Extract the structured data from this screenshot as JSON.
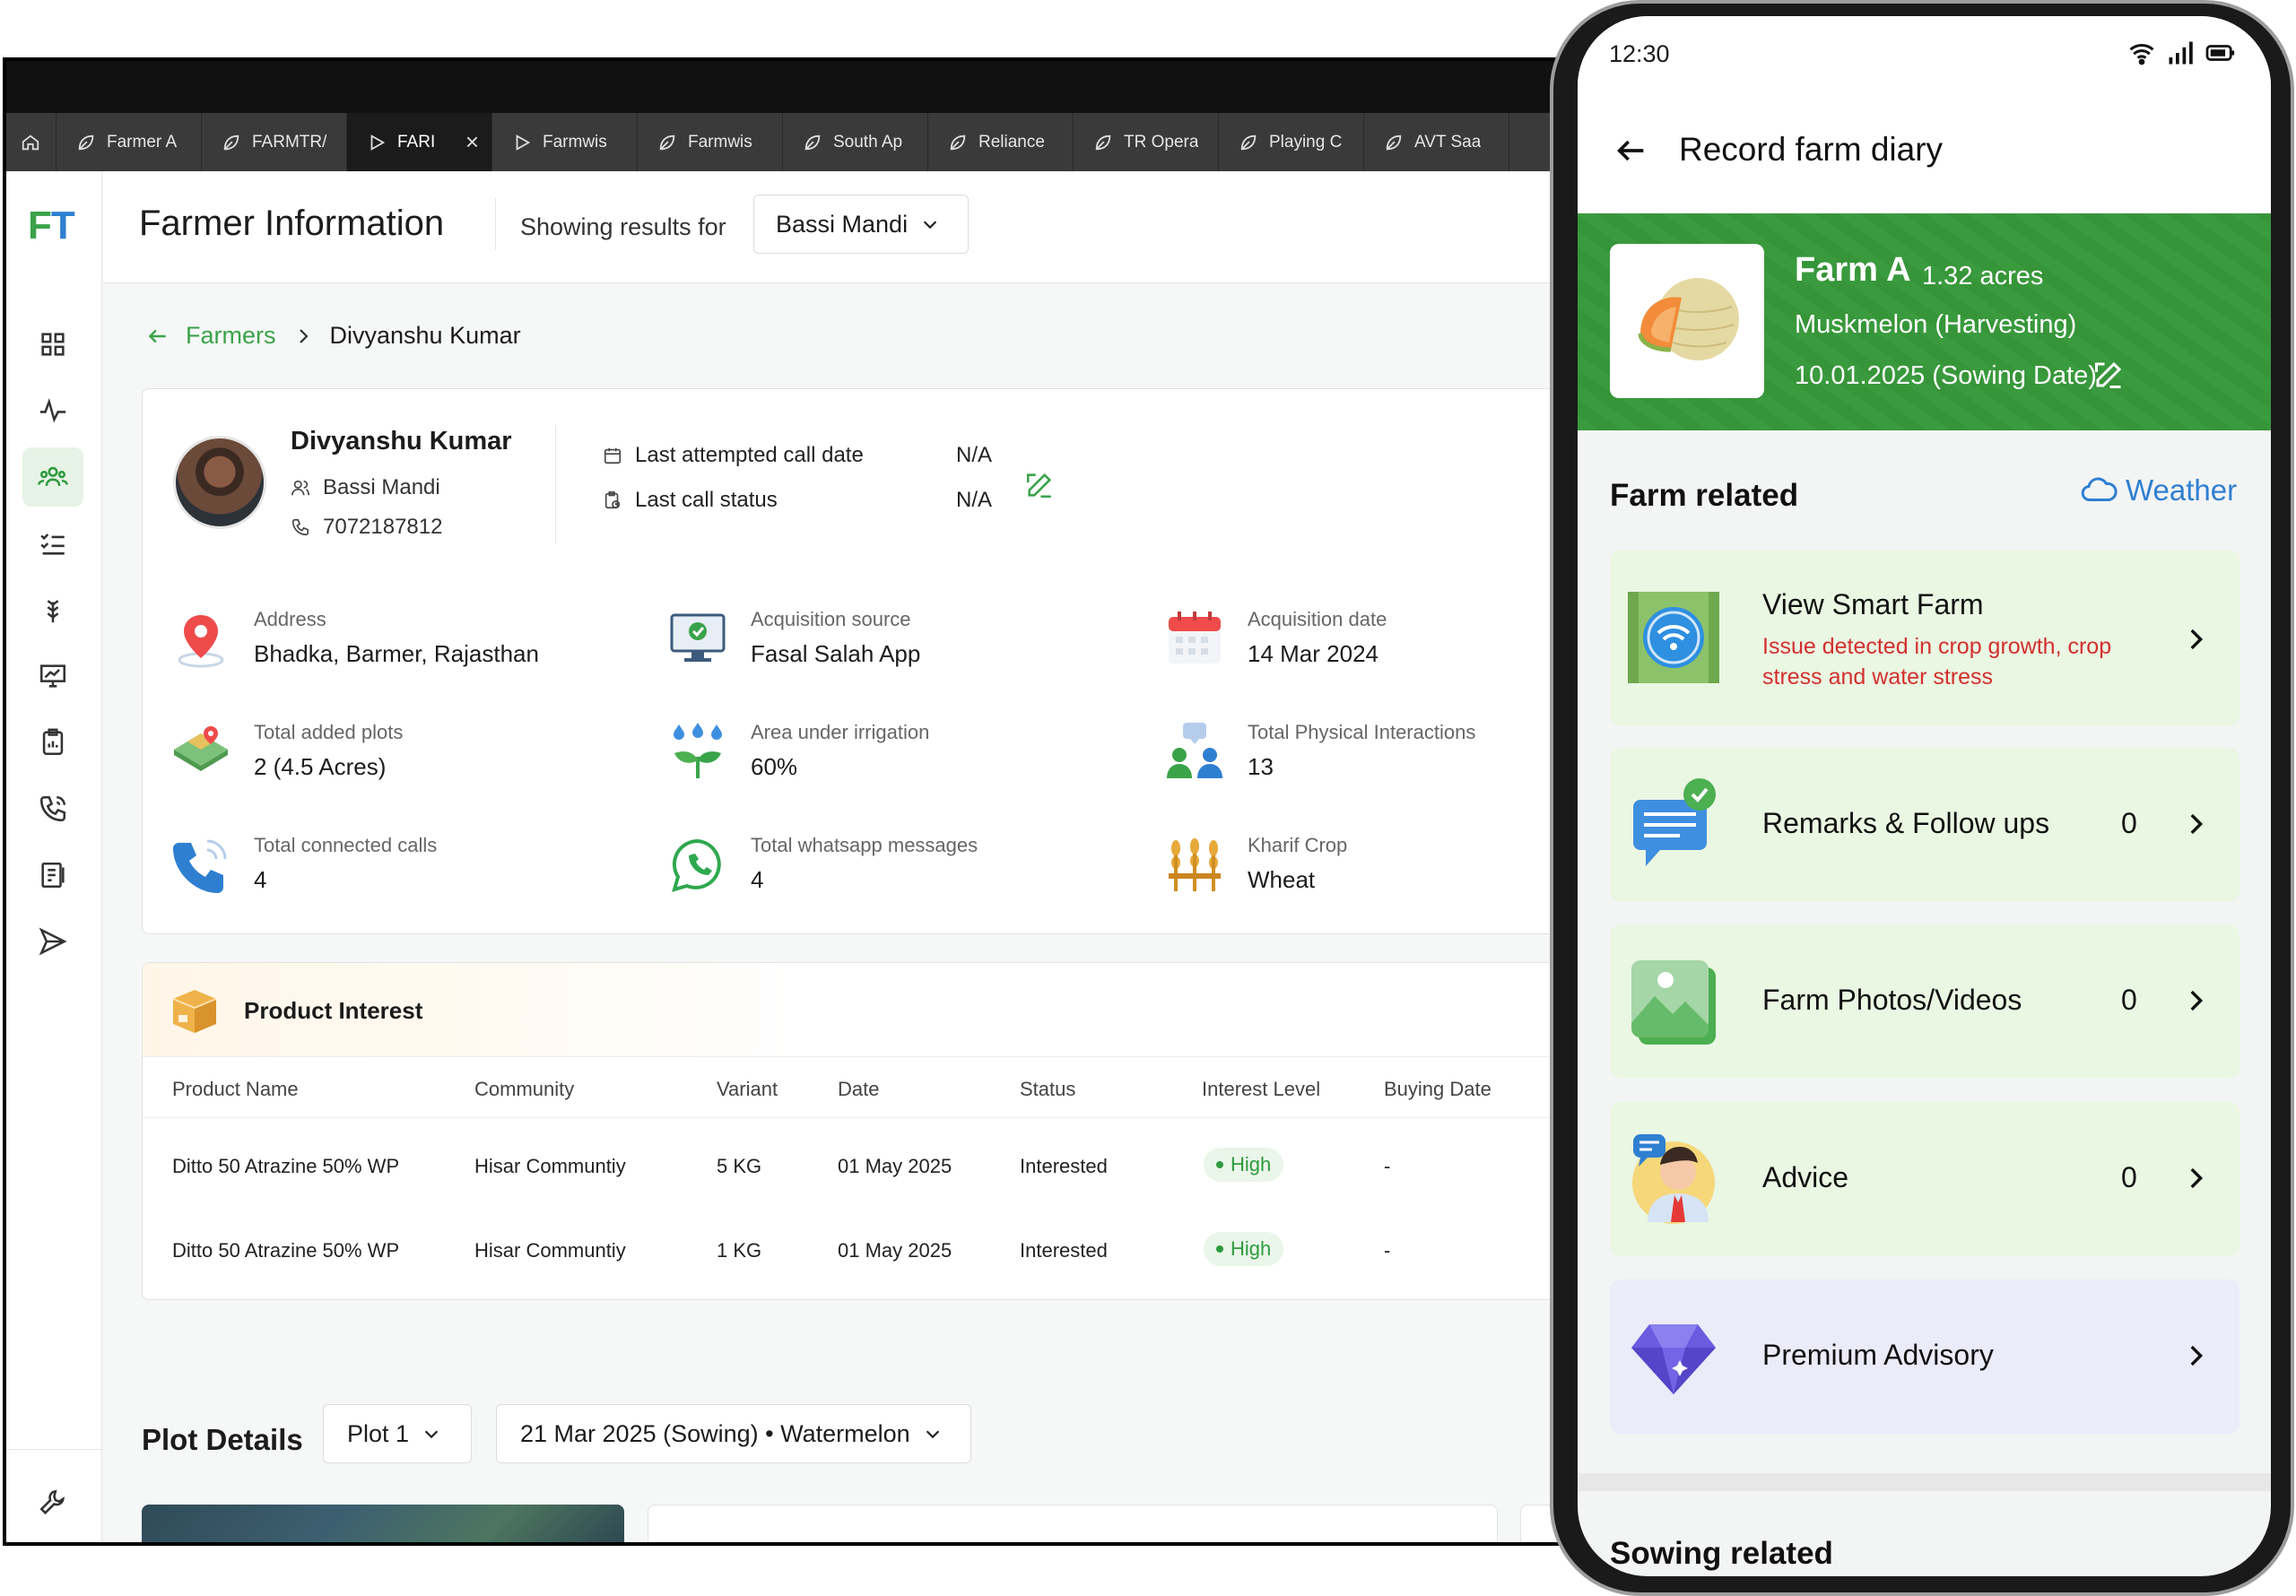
{
  "tabs": [
    {
      "label": "Farmer A",
      "icon": "leaf-icon"
    },
    {
      "label": "FARMTR/",
      "icon": "leaf-icon"
    },
    {
      "label": "FARI",
      "icon": "play-icon",
      "active": true
    },
    {
      "label": "Farmwis",
      "icon": "play-icon"
    },
    {
      "label": "Farmwis",
      "icon": "leaf-icon"
    },
    {
      "label": "South Ap",
      "icon": "leaf-icon"
    },
    {
      "label": "Reliance",
      "icon": "leaf-icon"
    },
    {
      "label": "TR Opera",
      "icon": "leaf-icon"
    },
    {
      "label": "Playing C",
      "icon": "leaf-icon"
    },
    {
      "label": "AVT Saa",
      "icon": "leaf-icon"
    }
  ],
  "logo": {
    "f": "F",
    "t": "T"
  },
  "header": {
    "title": "Farmer Information",
    "showing": "Showing results for",
    "mandi": "Bassi Mandi"
  },
  "breadcrumb": {
    "parent": "Farmers",
    "current": "Divyanshu Kumar"
  },
  "farmer": {
    "name": "Divyanshu Kumar",
    "mandi": "Bassi Mandi",
    "phone": "7072187812",
    "last_call_label": "Last attempted call date",
    "last_call_value": "N/A",
    "last_status_label": "Last call status",
    "last_status_value": "N/A"
  },
  "stats": [
    {
      "label": "Address",
      "value": "Bhadka, Barmer, Rajasthan",
      "icon": "location-pin-icon"
    },
    {
      "label": "Acquisition source",
      "value": "Fasal Salah App",
      "icon": "monitor-check-icon"
    },
    {
      "label": "Acquisition date",
      "value": "14 Mar 2024",
      "icon": "calendar-icon"
    },
    {
      "label": "Total added plots",
      "value": "2 (4.5 Acres)",
      "icon": "plots-map-icon"
    },
    {
      "label": "Area under irrigation",
      "value": "60%",
      "icon": "irrigation-sprout-icon"
    },
    {
      "label": "Total Physical Interactions",
      "value": "13",
      "icon": "people-chat-icon"
    },
    {
      "label": "Total connected calls",
      "value": "4",
      "icon": "phone-call-icon"
    },
    {
      "label": "Total whatsapp messages",
      "value": "4",
      "icon": "whatsapp-icon"
    },
    {
      "label": "Kharif Crop",
      "value": "Wheat",
      "icon": "wheat-icon"
    }
  ],
  "products": {
    "title": "Product Interest",
    "columns": [
      "Product Name",
      "Community",
      "Variant",
      "Date",
      "Status",
      "Interest Level",
      "Buying Date"
    ],
    "rows": [
      [
        "Ditto 50 Atrazine 50% WP",
        "Hisar Communtiy",
        "5 KG",
        "01 May 2025",
        "Interested",
        "High",
        "-"
      ],
      [
        "Ditto 50 Atrazine 50% WP",
        "Hisar Communtiy",
        "1 KG",
        "01 May 2025",
        "Interested",
        "High",
        "-"
      ]
    ]
  },
  "plot": {
    "title": "Plot Details",
    "plot_select": "Plot 1",
    "season_select": "21 Mar 2025 (Sowing) • Watermelon"
  },
  "phone": {
    "time": "12:30",
    "title": "Record farm diary",
    "farm_name": "Farm A",
    "farm_acres": "1.32 acres",
    "farm_crop": "Muskmelon (Harvesting)",
    "farm_sowing": "10.01.2025 (Sowing Date)",
    "section": "Farm related",
    "weather": "Weather",
    "cards": [
      {
        "label": "View Smart Farm",
        "issue": "Issue  detected in crop growth, crop stress and water stress",
        "icon": "wifi-farm-icon"
      },
      {
        "label": "Remarks & Follow ups",
        "count": "0",
        "icon": "chat-check-icon"
      },
      {
        "label": "Farm Photos/Videos",
        "count": "0",
        "icon": "photo-gallery-icon"
      },
      {
        "label": "Advice",
        "count": "0",
        "icon": "advisor-avatar-icon"
      },
      {
        "label": "Premium Advisory",
        "icon": "diamond-icon"
      }
    ],
    "next_section": "Sowing related"
  },
  "colors": {
    "brand_green": "#3aa34a",
    "brand_blue": "#2f7fd1",
    "banner_green": "#3a9a3e",
    "issue_red": "#d32f2f",
    "card_green": "#eaf7e2",
    "card_purple": "#ebebfa"
  }
}
